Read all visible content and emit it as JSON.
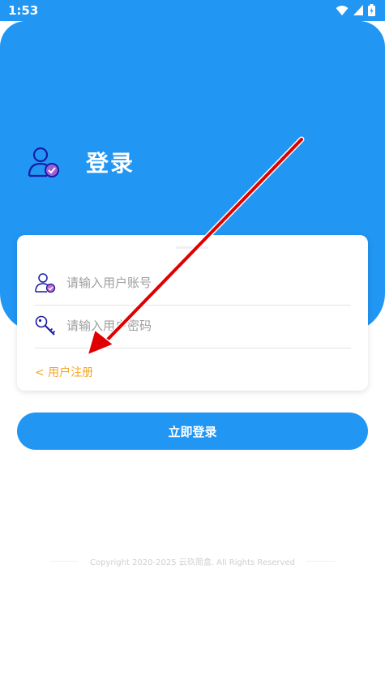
{
  "status_bar": {
    "time": "1:53"
  },
  "header": {
    "title": "登录"
  },
  "form": {
    "username_placeholder": "请输入用户账号",
    "password_placeholder": "请输入用户密码",
    "register_link": "< 用户注册"
  },
  "actions": {
    "login_button": "立即登录"
  },
  "footer": {
    "copyright": "Copyright 2020-2025 云玖简盒. All Rights Reserved"
  },
  "colors": {
    "primary": "#2196F3",
    "accent_link": "#f5a623",
    "annotation_arrow": "#e00000"
  },
  "icons": {
    "title": "user-check-icon",
    "username": "user-check-icon",
    "password": "key-icon"
  }
}
